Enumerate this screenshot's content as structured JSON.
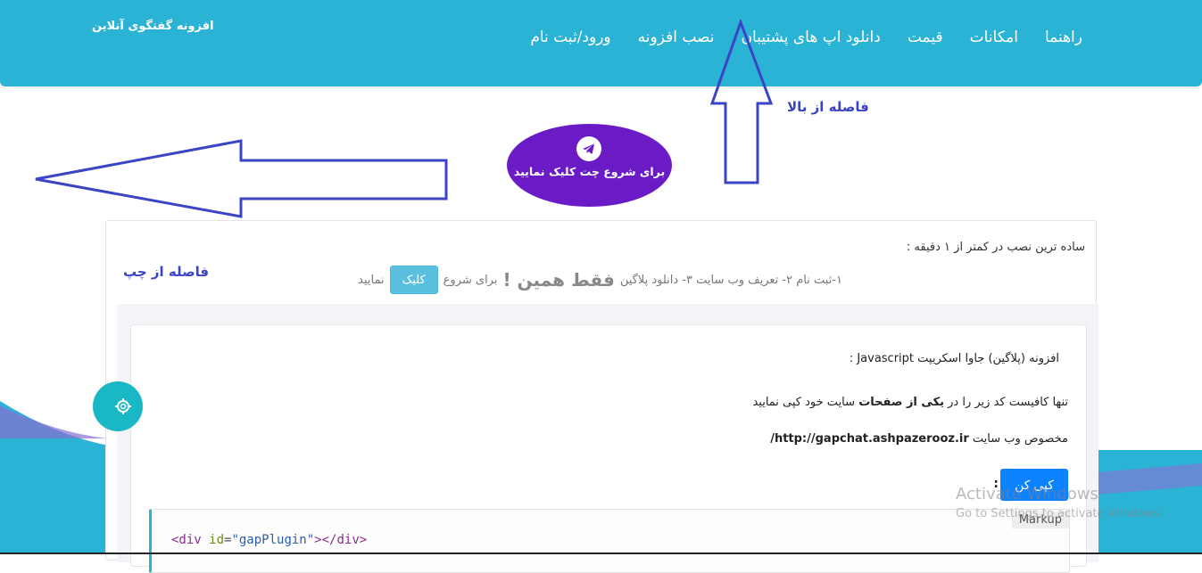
{
  "header": {
    "brand": "افزونه گفتگوی آنلاین",
    "nav": [
      {
        "label": "ورود/ثبت نام"
      },
      {
        "label": "نصب افزونه"
      },
      {
        "label": "دانلود اپ های پشتیبان"
      },
      {
        "label": "قیمت"
      },
      {
        "label": "امکانات"
      },
      {
        "label": "راهنما"
      }
    ]
  },
  "annotations": {
    "top_label": "فاصله از بالا",
    "left_label": "فاصله از چپ"
  },
  "start_chat": {
    "label": "برای شروع چت کلیک نمایید",
    "icon": "telegram-icon"
  },
  "card": {
    "intro_line1": "ساده ترین نصب در کمتر از ۱ دقیقه :",
    "intro_steps": "۱-ثبت نام ۲- تعریف وب سایت ۳- دانلود پلاگین",
    "intro_emphasis": "فقط همین !",
    "intro_pre_button": "برای شروع",
    "click_button": "کلیک",
    "intro_post_button": "نمایید",
    "plugin_title": "افزونه (پلاگین) جاوا اسکریپت Javascript :",
    "copy_instruction_pre": "تنها کافیست کد زیر را در",
    "copy_instruction_bold": "یکی از صفحات",
    "copy_instruction_post": "سایت خود کپی نمایید",
    "site_prefix": "مخصوص وب سایت",
    "site_url": "http://gapchat.ashpazerooz.ir/",
    "copy_button": "کپی کن",
    "colon": ":",
    "code_tag": "Markup",
    "code": {
      "open": "<div",
      "attr": "id",
      "eq": "=",
      "value": "\"gapPlugin\"",
      "close": "></div>"
    }
  },
  "watermark": {
    "line1": "Activate Windows",
    "line2": "Go to Settings to activate Windows."
  },
  "colors": {
    "header": "#2bb3d6",
    "start_chat": "#6a1bc6",
    "annotation": "#3b44c4",
    "copy_button": "#0d82ff",
    "click_button": "#5bc0de",
    "gear": "#1ab8c4"
  }
}
